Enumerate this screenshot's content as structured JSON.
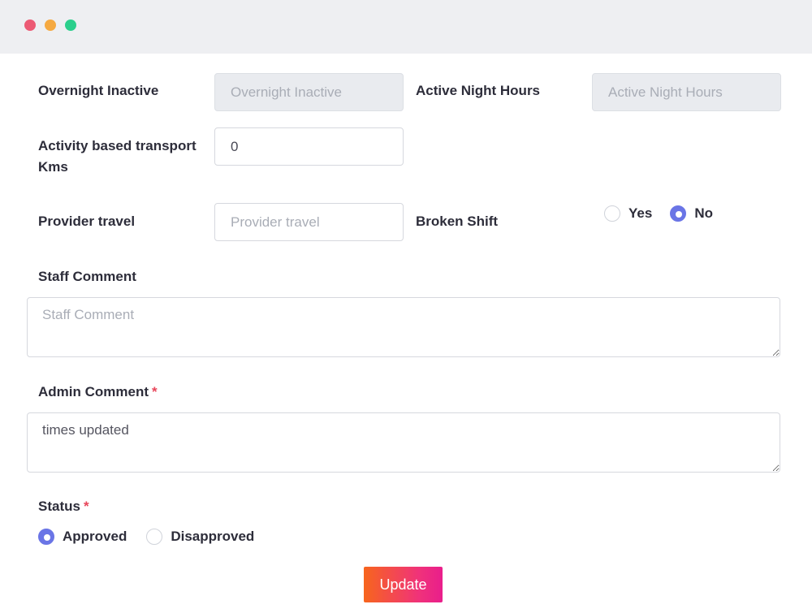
{
  "window": {
    "controls": [
      "close",
      "minimize",
      "maximize"
    ]
  },
  "form": {
    "overnight_inactive": {
      "label": "Overnight Inactive",
      "placeholder": "Overnight Inactive",
      "value": ""
    },
    "active_night_hours": {
      "label": "Active Night Hours",
      "placeholder": "Active Night Hours",
      "value": ""
    },
    "activity_transport": {
      "label_line1": "Activity based transport",
      "label_line2": "Kms",
      "value": "0"
    },
    "provider_travel": {
      "label": "Provider travel",
      "placeholder": "Provider travel",
      "value": ""
    },
    "broken_shift": {
      "label": "Broken Shift",
      "options": [
        {
          "label": "Yes",
          "checked": false
        },
        {
          "label": "No",
          "checked": true
        }
      ]
    },
    "staff_comment": {
      "label": "Staff Comment",
      "placeholder": "Staff Comment",
      "value": ""
    },
    "admin_comment": {
      "label": "Admin Comment",
      "required_mark": "*",
      "value": "times updated"
    },
    "status": {
      "label": "Status",
      "required_mark": "*",
      "options": [
        {
          "label": "Approved",
          "checked": true
        },
        {
          "label": "Disapproved",
          "checked": false
        }
      ]
    },
    "submit_label": "Update"
  },
  "colors": {
    "accent": "#6a75e6",
    "required": "#e8465a",
    "button_gradient_start": "#f7651d",
    "button_gradient_end": "#e91e8c"
  }
}
